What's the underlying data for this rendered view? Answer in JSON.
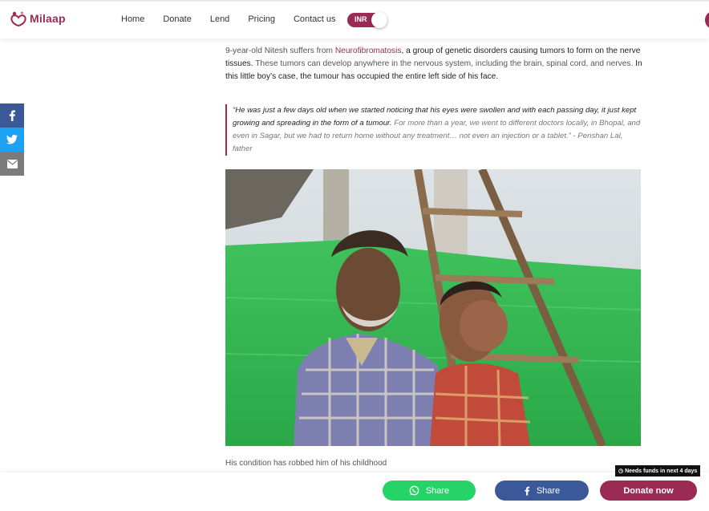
{
  "header": {
    "logo_text": "Milaap",
    "nav": [
      "Home",
      "Donate",
      "Lend",
      "Pricing",
      "Contact us"
    ],
    "currency": "INR"
  },
  "sidebar": {
    "icons": [
      "facebook-icon",
      "twitter-icon",
      "mail-icon"
    ]
  },
  "story": {
    "intro_a": "9-year-old Nitesh suffers from ",
    "intro_link": "Neurofibromatosis",
    "intro_b": ", a group of genetic disorders causing tumors to form on the nerve ",
    "intro_c": "tissues.",
    "intro_d": " These tumors can develop anywhere in the nervous system, including the brain, spinal cord, and nerves. ",
    "intro_e": "In this little boy’s case, the tumour has occupied the entire left side of his face.",
    "quote_strong": "“He was just a few days old when we started noticing that his eyes were swollen and with each passing day, it just kept growing and spreading in the form of a tumour.",
    "quote_rest": " For more than a year, we went to different doctors locally, in Bhopal, and even in Sagar, but we had to return home without any treatment… not even an injection or a tablet.” - Penshan Lal, father",
    "caption": "His condition has robbed him of his childhood"
  },
  "footer": {
    "needs_funds": "Needs funds in next 4 days",
    "whatsapp_share": "Share",
    "facebook_share": "Share",
    "donate": "Donate now"
  },
  "colors": {
    "brand": "#9c2b53",
    "whatsapp": "#25d366",
    "facebook": "#3b5998",
    "twitter": "#1da1f2"
  }
}
